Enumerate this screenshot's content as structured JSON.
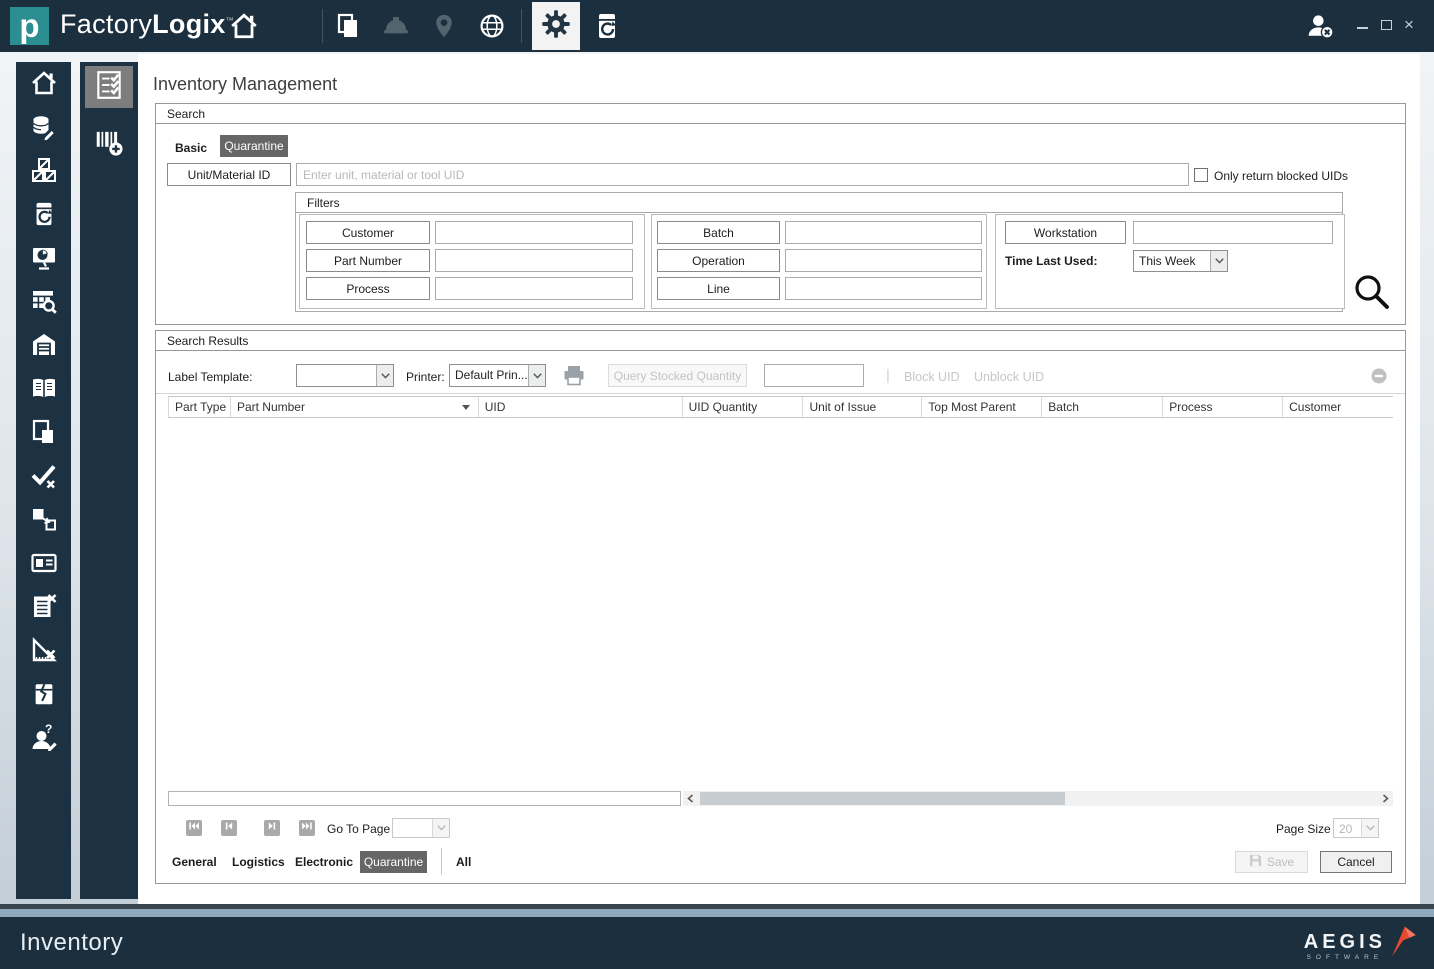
{
  "topbar": {
    "brand_left": "Factory",
    "brand_right": "Logix",
    "brand_tm": "™"
  },
  "sidebar": {
    "items": [
      "home",
      "database-edit",
      "crates",
      "container-history",
      "monitor-chart",
      "table-search",
      "warehouse",
      "book",
      "pages",
      "check-remove",
      "box-transfer",
      "id-card",
      "list-remove",
      "ruler-remove",
      "damaged-container",
      "person-question-edit"
    ],
    "panel2_items": [
      "inventory-checklist",
      "barcode-add"
    ]
  },
  "page": {
    "title": "Inventory Management"
  },
  "search": {
    "header": "Search",
    "tab_basic": "Basic",
    "tab_quarantine": "Quarantine",
    "unit_material_button": "Unit/Material ID",
    "unit_placeholder": "Enter unit, material or tool UID",
    "only_blocked": "Only return blocked UIDs",
    "filters_header": "Filters",
    "filter_customer": "Customer",
    "filter_part_number": "Part Number",
    "filter_process": "Process",
    "filter_batch": "Batch",
    "filter_operation": "Operation",
    "filter_line": "Line",
    "filter_workstation": "Workstation",
    "time_last_used_label": "Time Last Used:",
    "time_last_used_value": "This Week"
  },
  "results": {
    "header": "Search Results",
    "label_template": "Label Template:",
    "label_template_value": "",
    "printer_label": "Printer:",
    "printer_value": "Default Prin...",
    "query_stocked": "Query Stocked Quantity",
    "quantity_value": "",
    "block_uid": "Block UID",
    "unblock_uid": "Unblock UID",
    "columns": [
      "Part Type",
      "Part Number",
      "UID",
      "UID Quantity",
      "Unit of Issue",
      "Top Most Parent",
      "Batch",
      "Process",
      "Customer"
    ],
    "rows": []
  },
  "pagination": {
    "go_to_page": "Go To Page",
    "go_to_page_value": "",
    "page_size_label": "Page Size",
    "page_size_value": "20"
  },
  "footer_tabs": {
    "general": "General",
    "logistics": "Logistics",
    "electronic": "Electronic",
    "quarantine": "Quarantine",
    "all": "All"
  },
  "actions": {
    "save": "Save",
    "cancel": "Cancel"
  },
  "statusbar": {
    "module": "Inventory",
    "brand": "AEGIS",
    "brand_sub": "SOFTWARE"
  }
}
